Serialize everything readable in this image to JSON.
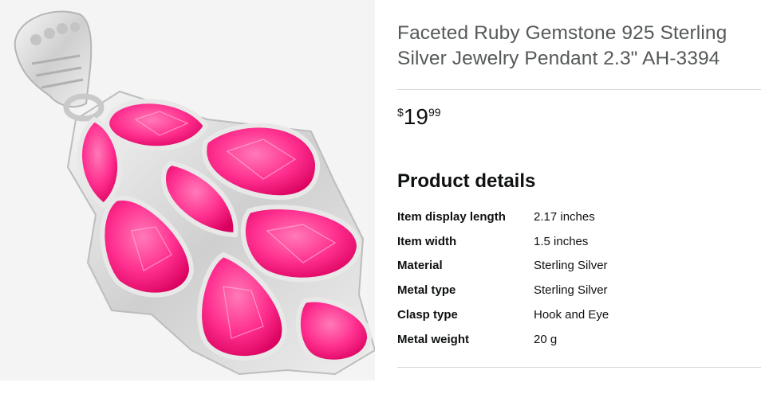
{
  "product": {
    "title": "Faceted Ruby Gemstone 925 Sterling Silver Jewelry Pendant 2.3\" AH-3394",
    "price": {
      "symbol": "$",
      "whole": "19",
      "fraction": "99"
    }
  },
  "details": {
    "heading": "Product details",
    "rows": [
      {
        "label": "Item display length",
        "value": "2.17 inches"
      },
      {
        "label": "Item width",
        "value": "1.5 inches"
      },
      {
        "label": "Material",
        "value": "Sterling Silver"
      },
      {
        "label": "Metal type",
        "value": "Sterling Silver"
      },
      {
        "label": "Clasp type",
        "value": "Hook and Eye"
      },
      {
        "label": "Metal weight",
        "value": "20 g"
      }
    ]
  },
  "colors": {
    "gem": "#ff2f8f",
    "silver": "#dcdcdc",
    "title_text": "#565959",
    "body_text": "#0f1111"
  }
}
